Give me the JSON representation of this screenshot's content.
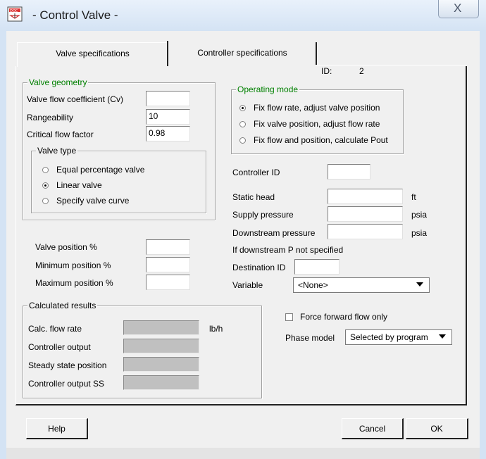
{
  "window": {
    "title": "- Control Valve -",
    "close_glyph": "X"
  },
  "tabs": {
    "valve": "Valve specifications",
    "controller": "Controller specifications"
  },
  "id": {
    "label": "ID:",
    "value": "2"
  },
  "valve_geometry": {
    "legend": "Valve geometry",
    "cv_label": "Valve flow coefficient (Cv)",
    "cv_value": "",
    "rangeability_label": "Rangeability",
    "rangeability_value": "10",
    "critical_label": "Critical flow factor",
    "critical_value": "0.98",
    "valve_type": {
      "legend": "Valve type",
      "options": [
        "Equal percentage valve",
        "Linear valve",
        "Specify valve curve"
      ],
      "selected": "Linear valve"
    }
  },
  "positions": {
    "valve_position_label": "Valve position %",
    "valve_position_value": "",
    "minimum_label": "Minimum position %",
    "minimum_value": "",
    "maximum_label": "Maximum position %",
    "maximum_value": ""
  },
  "calculated": {
    "legend": "Calculated results",
    "flow_rate_label": "Calc. flow rate",
    "flow_rate_unit": "lb/h",
    "controller_output_label": "Controller output",
    "steady_state_label": "Steady state position",
    "controller_output_ss_label": "Controller output SS"
  },
  "operating_mode": {
    "legend": "Operating mode",
    "options": [
      "Fix flow rate, adjust valve position",
      "Fix valve position, adjust flow rate",
      "Fix flow and position, calculate Pout"
    ],
    "selected": "Fix flow rate, adjust valve position"
  },
  "controller_id": {
    "label": "Controller ID",
    "value": ""
  },
  "pressures": {
    "static_head_label": "Static head",
    "static_head_unit": "ft",
    "supply_label": "Supply pressure",
    "supply_unit": "psia",
    "downstream_label": "Downstream pressure",
    "downstream_unit": "psia",
    "note": "If downstream P not specified",
    "destination_label": "Destination ID",
    "variable_label": "Variable",
    "variable_value": "<None>"
  },
  "force_forward": {
    "label": "Force forward flow only",
    "checked": false
  },
  "phase_model": {
    "label": "Phase model",
    "value": "Selected by program"
  },
  "buttons": {
    "help": "Help",
    "cancel": "Cancel",
    "ok": "OK"
  },
  "colors": {
    "group_legend_green": "#008000",
    "calc_field_gray": "#c0c0c0"
  },
  "icons": {
    "app": "control-valve-app-icon",
    "close": "close-icon",
    "dropdown": "chevron-down-icon"
  }
}
